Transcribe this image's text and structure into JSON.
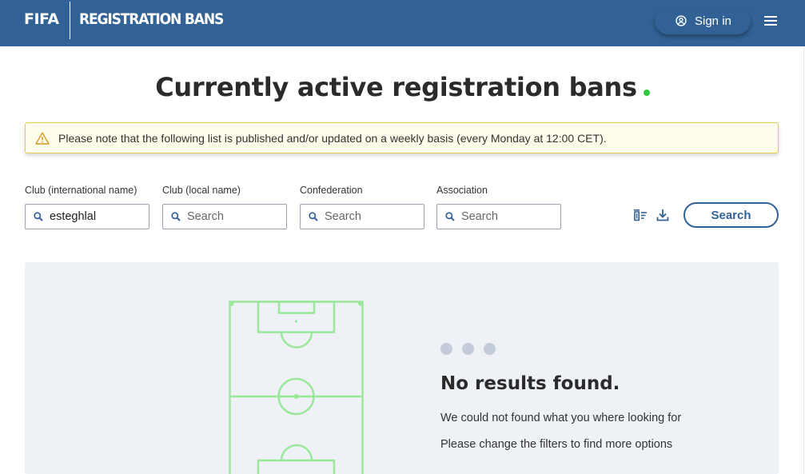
{
  "header": {
    "brand": "FIFA",
    "subtitle": "REGISTRATION BANS",
    "sign_in_label": "Sign in",
    "colors": {
      "bar": "#326295"
    }
  },
  "page": {
    "title": "Currently active registration bans",
    "status_color": "#2ecc40"
  },
  "notice": {
    "text": "Please note that the following list is published and/or updated on a weekly basis (every Monday at 12:00 CET).",
    "icon": "warning-icon"
  },
  "filters": {
    "club_international": {
      "label": "Club (international name)",
      "value": "esteghlal",
      "placeholder": "Search"
    },
    "club_local": {
      "label": "Club (local name)",
      "value": "",
      "placeholder": "Search"
    },
    "confederation": {
      "label": "Confederation",
      "value": "",
      "placeholder": "Search"
    },
    "association": {
      "label": "Association",
      "value": "",
      "placeholder": "Search"
    },
    "search_button": "Search",
    "icons": [
      "clear-filters-icon",
      "download-icon"
    ]
  },
  "results": {
    "heading": "No results found.",
    "line1": "We could not found what you where looking for",
    "line2": "Please change the filters to find more options",
    "illustration": "football-pitch-icon",
    "pitch_color": "#9be79b"
  }
}
